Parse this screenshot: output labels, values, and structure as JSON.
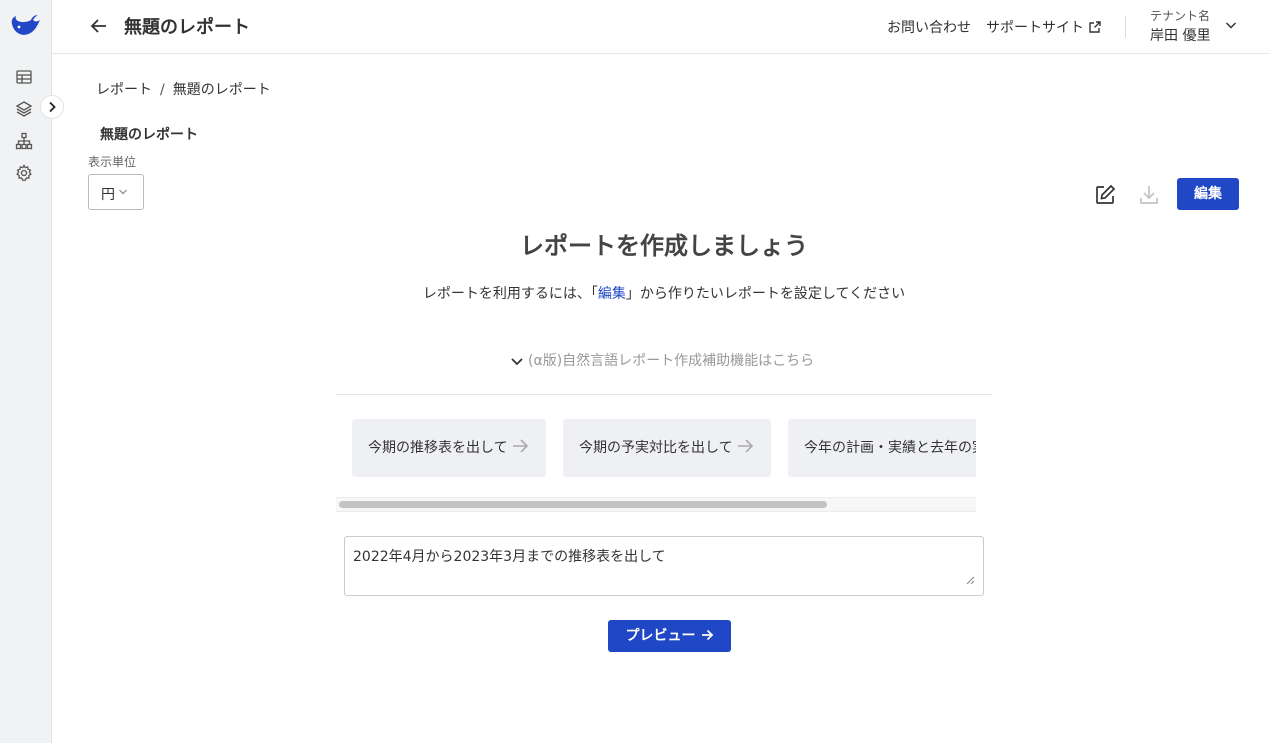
{
  "header": {
    "title": "無題のレポート",
    "contact_label": "お問い合わせ",
    "support_label": "サポートサイト",
    "tenant_label": "テナント名",
    "user_name": "岸田 優里"
  },
  "breadcrumb": {
    "parent": "レポート",
    "separator": "/",
    "current": "無題のレポート"
  },
  "report": {
    "name": "無題のレポート",
    "unit_label": "表示単位",
    "unit_value": "円",
    "edit_button": "編集"
  },
  "empty_state": {
    "heading": "レポートを作成しましょう",
    "instruction_before": "レポートを利用するには、「",
    "instruction_link": "編集",
    "instruction_after": "」から作りたいレポートを設定してください"
  },
  "nl_assist": {
    "toggle_label": "(α版)自然言語レポート作成補助機能はこちら",
    "suggestions": [
      "今期の推移表を出して",
      "今期の予実対比を出して",
      "今年の計画・実績と去年の実績を出して"
    ],
    "scroll_fraction": 0.77,
    "prompt_text": "2022年4月から2023年3月までの推移表を出して",
    "preview_button": "プレビュー"
  },
  "icons": {
    "sidebar": [
      "whale-logo-icon",
      "table-icon",
      "layers-icon",
      "hierarchy-icon",
      "settings-icon"
    ],
    "toolbar": [
      "pencil-edit-icon",
      "download-icon"
    ]
  },
  "colors": {
    "primary": "#1f47c6",
    "sidebar_bg": "#f1f2f4",
    "chip_bg": "#eff0f3"
  }
}
